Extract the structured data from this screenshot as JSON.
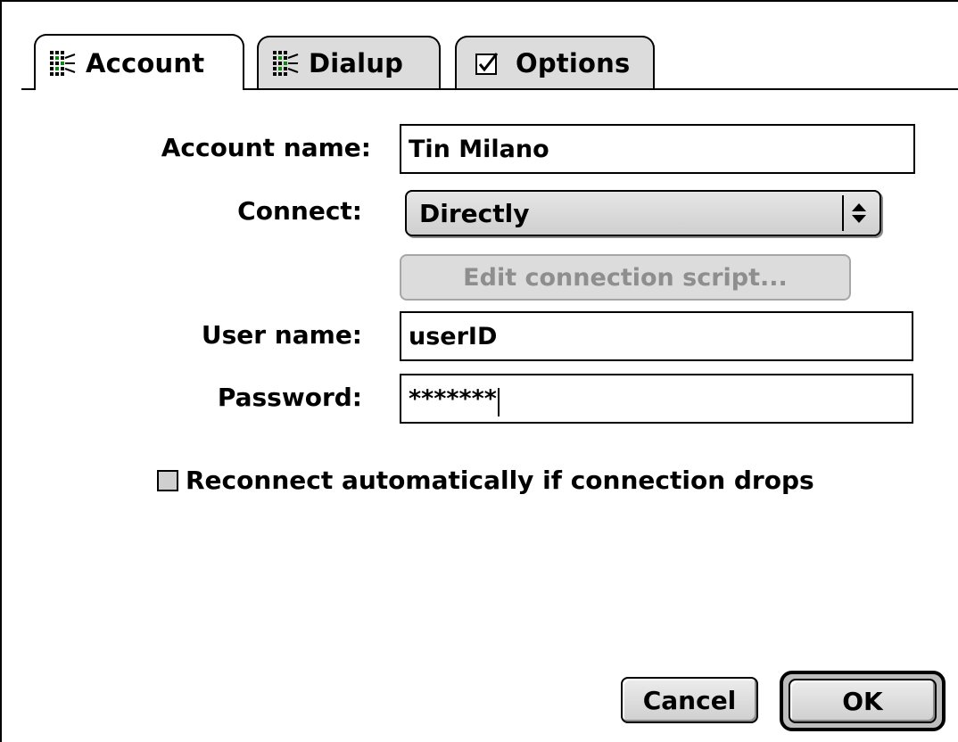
{
  "tabs": [
    {
      "label": "Account",
      "icon": "network-grid-icon",
      "active": true
    },
    {
      "label": "Dialup",
      "icon": "network-grid-icon",
      "active": false
    },
    {
      "label": "Options",
      "icon": "checkbox-checked-icon",
      "active": false
    }
  ],
  "form": {
    "account_name_label": "Account name:",
    "account_name_value": "Tin Milano",
    "connect_label": "Connect:",
    "connect_value": "Directly",
    "edit_script_label": "Edit connection script...",
    "user_name_label": "User name:",
    "user_name_value": "userID",
    "password_label": "Password:",
    "password_value": "*******",
    "reconnect_label": "Reconnect automatically if connection drops",
    "reconnect_checked": false
  },
  "buttons": {
    "cancel_label": "Cancel",
    "ok_label": "OK"
  },
  "icons": {
    "popup_arrows": "up-down-arrows-icon"
  }
}
